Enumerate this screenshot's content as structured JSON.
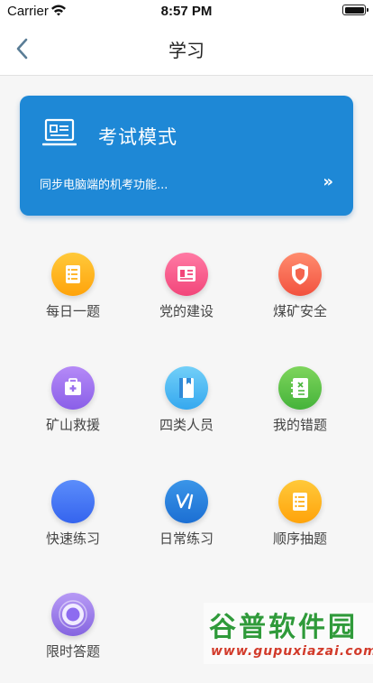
{
  "status_bar": {
    "carrier": "Carrier",
    "time": "8:57 PM"
  },
  "nav": {
    "title": "学习",
    "back_icon": "chevron-left-icon"
  },
  "exam_card": {
    "title": "考试模式",
    "description": "同步电脑端的机考功能...",
    "arrow": "»",
    "icon": "laptop-icon",
    "color": "#1e88d6"
  },
  "menu": [
    {
      "label": "每日一题",
      "icon": "list-icon",
      "color_top": "#ffc93a",
      "color_bottom": "#ffa30b"
    },
    {
      "label": "党的建设",
      "icon": "party-flag-icon",
      "color_top": "#ff7aa4",
      "color_bottom": "#f2467a"
    },
    {
      "label": "煤矿安全",
      "icon": "shield-icon",
      "color_top": "#ff8c6e",
      "color_bottom": "#f2523f"
    },
    {
      "label": "矿山救援",
      "icon": "first-aid-kit-icon",
      "color_top": "#b58af7",
      "color_bottom": "#8a5fe8"
    },
    {
      "label": "四类人员",
      "icon": "book-icon",
      "color_top": "#72cff8",
      "color_bottom": "#35a8ef"
    },
    {
      "label": "我的错题",
      "icon": "notebook-icon",
      "color_top": "#7ed55c",
      "color_bottom": "#45b33a"
    },
    {
      "label": "快速练习",
      "icon": "blue-circle-icon",
      "color_top": "#5b8dfb",
      "color_bottom": "#3564ee"
    },
    {
      "label": "日常练习",
      "icon": "vi-logo-icon",
      "color_top": "#3a95e8",
      "color_bottom": "#1c6fd3"
    },
    {
      "label": "顺序抽题",
      "icon": "list-icon",
      "color_top": "#ffc93a",
      "color_bottom": "#ffa30b"
    },
    {
      "label": "限时答题",
      "icon": "ring-icon",
      "color_top": "#b79af5",
      "color_bottom": "#8565e0"
    }
  ],
  "watermark": {
    "line1": "谷普软件园",
    "line2": "www.gupuxiazai.com"
  }
}
